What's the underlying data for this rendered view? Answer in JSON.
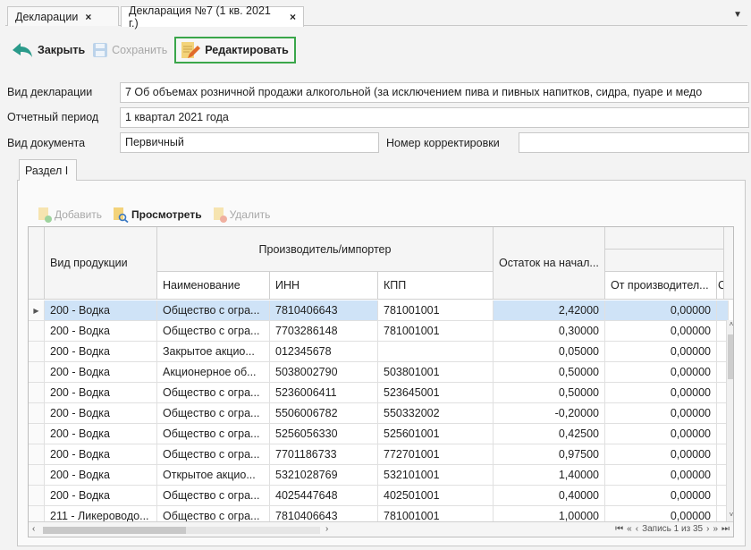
{
  "tabs": [
    {
      "label": "Декларации",
      "close": "×"
    },
    {
      "label": "Декларация №7 (1 кв. 2021 г.)",
      "close": "×"
    }
  ],
  "tab_menu": "▼",
  "toolbar": {
    "close_label": "Закрыть",
    "save_label": "Сохранить",
    "edit_label": "Редактировать"
  },
  "form": {
    "decl_type_label": "Вид декларации",
    "decl_type_value": "7 Об объемах розничной продажи алкогольной (за исключением пива и пивных напитков, сидра, пуаре и медо",
    "period_label": "Отчетный период",
    "period_value": "1 квартал 2021 года",
    "doc_type_label": "Вид документа",
    "doc_type_value": "Первичный",
    "correction_label": "Номер корректировки",
    "correction_value": ""
  },
  "section_tab": "Раздел I",
  "sub_toolbar": {
    "add_label": "Добавить",
    "view_label": "Просмотреть",
    "delete_label": "Удалить"
  },
  "grid": {
    "headers": {
      "product": "Вид продукции",
      "producer": "Производитель/импортер",
      "name": "Наименование",
      "inn": "ИНН",
      "kpp": "КПП",
      "balance": "Остаток на начал...",
      "from_producer": "От производител...",
      "cut": "С"
    },
    "rows": [
      {
        "product": "200 - Водка",
        "name": "Общество с огра...",
        "inn": "7810406643",
        "kpp": "781001001",
        "balance": "2,42000",
        "from_producer": "0,00000"
      },
      {
        "product": "200 - Водка",
        "name": "Общество с огра...",
        "inn": "7703286148",
        "kpp": "781001001",
        "balance": "0,30000",
        "from_producer": "0,00000"
      },
      {
        "product": "200 - Водка",
        "name": "Закрытое акцио...",
        "inn": "012345678",
        "kpp": "",
        "balance": "0,05000",
        "from_producer": "0,00000"
      },
      {
        "product": "200 - Водка",
        "name": "Акционерное об...",
        "inn": "5038002790",
        "kpp": "503801001",
        "balance": "0,50000",
        "from_producer": "0,00000"
      },
      {
        "product": "200 - Водка",
        "name": "Общество с огра...",
        "inn": "5236006411",
        "kpp": "523645001",
        "balance": "0,50000",
        "from_producer": "0,00000"
      },
      {
        "product": "200 - Водка",
        "name": "Общество с огра...",
        "inn": "5506006782",
        "kpp": "550332002",
        "balance": "-0,20000",
        "from_producer": "0,00000"
      },
      {
        "product": "200 - Водка",
        "name": "Общество с огра...",
        "inn": "5256056330",
        "kpp": "525601001",
        "balance": "0,42500",
        "from_producer": "0,00000"
      },
      {
        "product": "200 - Водка",
        "name": "Общество с огра...",
        "inn": "7701186733",
        "kpp": "772701001",
        "balance": "0,97500",
        "from_producer": "0,00000"
      },
      {
        "product": "200 - Водка",
        "name": "Открытое акцио...",
        "inn": "5321028769",
        "kpp": "532101001",
        "balance": "1,40000",
        "from_producer": "0,00000"
      },
      {
        "product": "200 - Водка",
        "name": "Общество с огра...",
        "inn": "4025447648",
        "kpp": "402501001",
        "balance": "0,40000",
        "from_producer": "0,00000"
      },
      {
        "product": "211 - Ликероводо...",
        "name": "Общество с огра...",
        "inn": "7810406643",
        "kpp": "781001001",
        "balance": "1,00000",
        "from_producer": "0,00000"
      }
    ]
  },
  "footer": {
    "record_text": "Запись 1 из 35"
  },
  "colors": {
    "highlight_border": "#3aa64a",
    "selected_row": "#cfe3f7"
  }
}
